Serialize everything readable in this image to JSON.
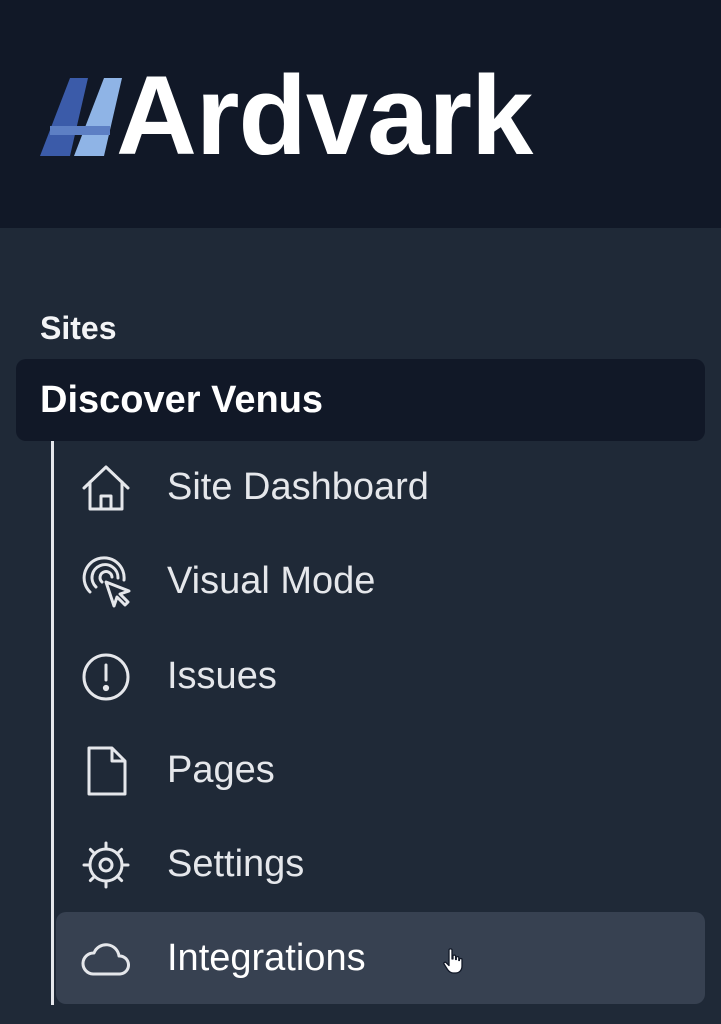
{
  "brand": {
    "name": "Ardvark",
    "logo_icon": "aa-logo-icon",
    "colors": {
      "header_bg": "#111827",
      "logo_blue_dark": "#3b5ba9",
      "logo_blue_light": "#8fb4e6"
    }
  },
  "sidebar": {
    "section_label": "Sites",
    "site_name": "Discover Venus",
    "items": [
      {
        "label": "Site Dashboard",
        "icon": "home-icon",
        "active": false
      },
      {
        "label": "Visual Mode",
        "icon": "cursor-click-icon",
        "active": false
      },
      {
        "label": "Issues",
        "icon": "exclamation-circle-icon",
        "active": false
      },
      {
        "label": "Pages",
        "icon": "document-icon",
        "active": false
      },
      {
        "label": "Settings",
        "icon": "gear-icon",
        "active": false
      },
      {
        "label": "Integrations",
        "icon": "cloud-icon",
        "active": true
      }
    ],
    "colors": {
      "bg": "#1f2937",
      "active_bg": "#374151",
      "text": "#e5e7eb"
    }
  }
}
